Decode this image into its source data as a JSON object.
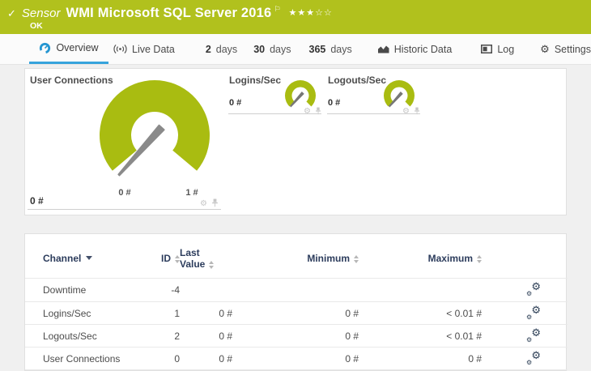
{
  "header": {
    "check_icon": "✓",
    "kind": "Sensor",
    "title": "WMI Microsoft SQL Server 2016",
    "flag_icon": "⚐",
    "stars_filled": "★★★",
    "stars_empty": "☆☆",
    "status": "OK"
  },
  "tabs": {
    "overview": {
      "label": "Overview"
    },
    "live_data": {
      "label": "Live Data"
    },
    "d2": {
      "num": "2",
      "unit": "days"
    },
    "d30": {
      "num": "30",
      "unit": "days"
    },
    "d365": {
      "num": "365",
      "unit": "days"
    },
    "historic": {
      "label": "Historic Data"
    },
    "log": {
      "label": "Log"
    },
    "settings": {
      "label": "Settings"
    }
  },
  "gauges": {
    "user_connections": {
      "title": "User Connections",
      "value": "0 #",
      "scale_min": "0 #",
      "scale_max": "1 #"
    },
    "logins": {
      "title": "Logins/Sec",
      "value": "0 #"
    },
    "logouts": {
      "title": "Logouts/Sec",
      "value": "0 #"
    }
  },
  "table": {
    "col_channel": "Channel",
    "col_id": "ID",
    "col_last_1": "Last",
    "col_last_2": "Value",
    "col_min": "Minimum",
    "col_max": "Maximum",
    "rows": [
      {
        "channel": "Downtime",
        "id": "-4",
        "last": "",
        "min": "",
        "max": ""
      },
      {
        "channel": "Logins/Sec",
        "id": "1",
        "last": "0 #",
        "min": "0 #",
        "max": "< 0.01 #"
      },
      {
        "channel": "Logouts/Sec",
        "id": "2",
        "last": "0 #",
        "min": "0 #",
        "max": "< 0.01 #"
      },
      {
        "channel": "User Connections",
        "id": "0",
        "last": "0 #",
        "min": "0 #",
        "max": "0 #"
      }
    ]
  },
  "colors": {
    "brand_green": "#b1c11d",
    "gauge_green": "#a9bc11",
    "accent_blue": "#36a3dc",
    "table_navy": "#2c3c5c",
    "needle_gray": "#8a8a8a"
  }
}
